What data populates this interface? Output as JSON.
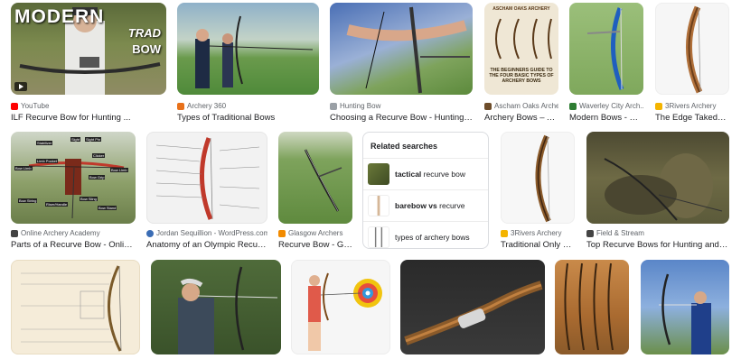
{
  "row1": [
    {
      "source": "YouTube",
      "title": "ILF Recurve Bow for Hunting ...",
      "overlay": "MODERN TRAD BOW",
      "fav": "#ff0000"
    },
    {
      "source": "Archery 360",
      "title": "Types of Traditional Bows",
      "fav": "#e8711a"
    },
    {
      "source": "Hunting Bow",
      "title": "Choosing a Recurve Bow - Hunting Bow",
      "fav": "#9aa0a6"
    },
    {
      "source": "Ascham Oaks Archery",
      "title": "Archery Bows – As...",
      "overlay": "THE BEGINNERS GUIDE TO THE FOUR BASIC TYPES OF ARCHERY BOWS",
      "header": "ASCHAM OAKS ARCHERY",
      "fav": "#6d4c2a"
    },
    {
      "source": "Waverley City Arch...",
      "title": "Modern Bows - Wa...",
      "fav": "#2e7d32"
    },
    {
      "source": "3Rivers Archery",
      "title": "The Edge Takedow...",
      "fav": "#f4b400"
    }
  ],
  "row2": [
    {
      "source": "Online Archery Academy",
      "title": "Parts of a Recurve Bow - Online ...",
      "fav": "#424242"
    },
    {
      "source": "Jordan Sequillion - WordPress.com",
      "title": "Anatomy of an Olympic Recurve...",
      "fav": "#3b6db5"
    },
    {
      "source": "Glasgow Archers",
      "title": "Recurve Bow - Gla...",
      "fav": "#f28b00"
    },
    {
      "source": "3Rivers Archery",
      "title": "Traditional Only 58...",
      "fav": "#f4b400"
    },
    {
      "source": "Field & Stream",
      "title": "Top Recurve Bows for Hunting and Targ...",
      "fav": "#444444"
    }
  ],
  "related": {
    "heading": "Related searches",
    "items": [
      {
        "bold": "tactical",
        "rest": " recurve bow"
      },
      {
        "bold": "barebow vs",
        "rest": " recurve"
      },
      {
        "bold": "",
        "rest": "types of archery bows"
      }
    ]
  },
  "diagram_labels": [
    "Stabilizer",
    "Sight",
    "Sight Pin",
    "Clicker",
    "Limb Pocket",
    "Bow Limb",
    "Bow Grip",
    "Bow Limb",
    "Bow String",
    "Riser/Handle",
    "Bow Sling",
    "Bow Stand"
  ],
  "colors": {
    "text": "#202124",
    "muted": "#5f6368",
    "border": "#dadce0"
  }
}
